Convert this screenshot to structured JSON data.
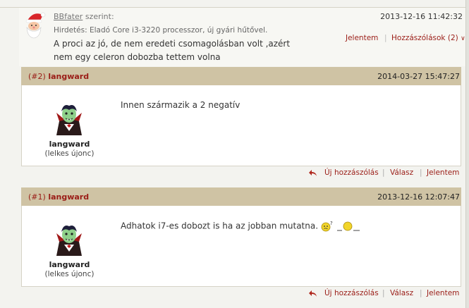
{
  "quote": {
    "author": "BBfater",
    "author_suffix": "szerint:",
    "date": "2013-12-16 11:42:32",
    "topic": "Hirdetés: Eladó Core i3-3220 processzor, új gyári hűtővel.",
    "text": "A proci az jó, de nem eredeti csomagolásban volt ,azért nem egy celeron dobozba tettem volna",
    "report_label": "Jelentem",
    "replies_label": "Hozzászólások (2)"
  },
  "posts": [
    {
      "number": "(#2)",
      "author": "langward",
      "date": "2014-03-27 15:47:27",
      "username": "langward",
      "rank": "(lelkes újonc)",
      "message": "Innen származik a 2 negatív",
      "new_reply_label": "Új hozzászólás",
      "reply_label": "Válasz",
      "report_label": "Jelentem"
    },
    {
      "number": "(#1)",
      "author": "langward",
      "date": "2013-12-16 12:07:47",
      "username": "langward",
      "rank": "(lelkes újonc)",
      "message": "Adhatok i7-es dobozt is ha az jobban mutatna.",
      "new_reply_label": "Új hozzászólás",
      "reply_label": "Válasz",
      "report_label": "Jelentem"
    }
  ],
  "colors": {
    "accent": "#9a1c16",
    "header_bg": "#cfc3a4",
    "page_bg": "#f3f3ef"
  }
}
